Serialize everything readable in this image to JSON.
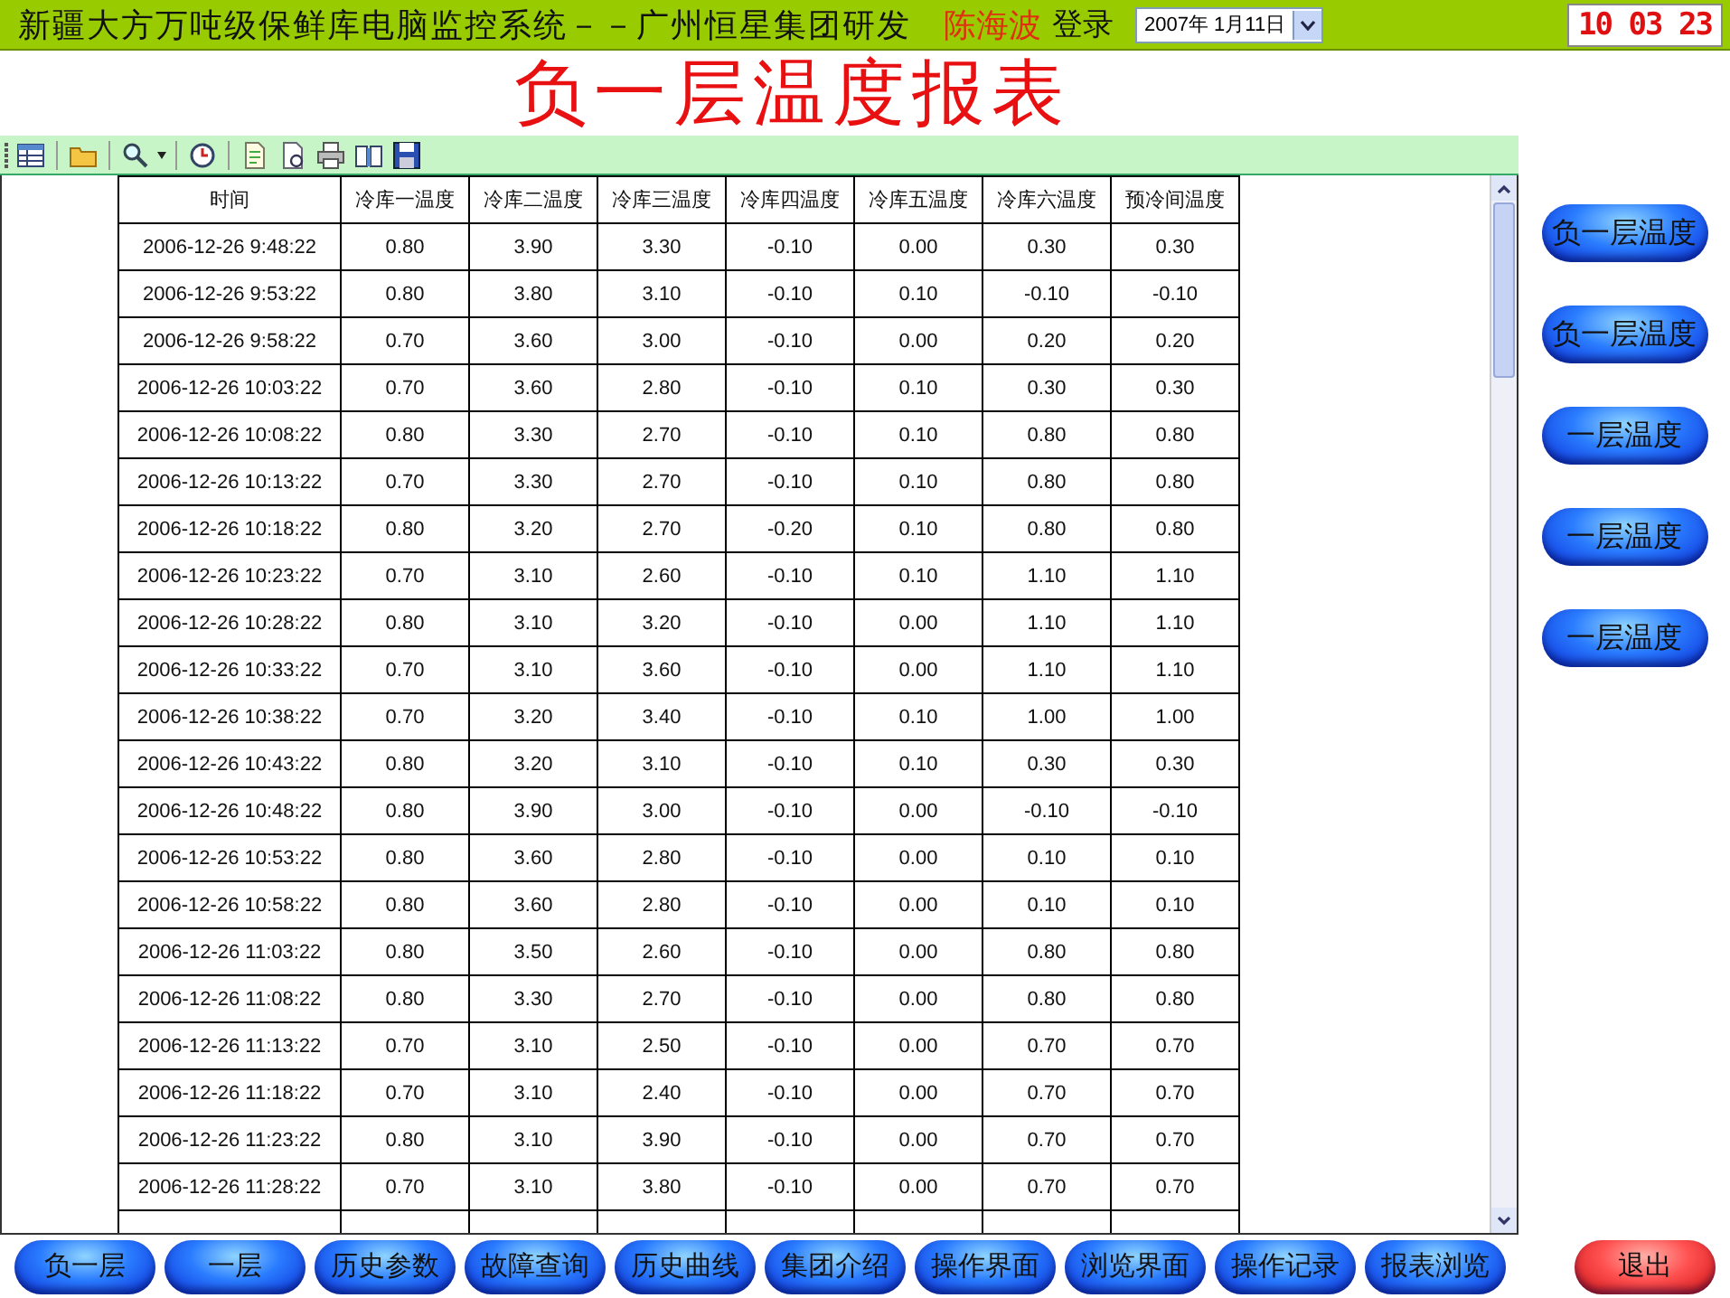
{
  "header": {
    "title": "新疆大方万吨级保鲜库电脑监控系统－－广州恒星集团研发",
    "user": "陈海波",
    "login": "登录",
    "date": "2007年 1月11日",
    "clock": "10 03 23"
  },
  "report_title": "负一层温度报表",
  "table": {
    "columns": [
      "时间",
      "冷库一温度",
      "冷库二温度",
      "冷库三温度",
      "冷库四温度",
      "冷库五温度",
      "冷库六温度",
      "预冷间温度"
    ],
    "rows": [
      [
        "2006-12-26 9:48:22",
        "0.80",
        "3.90",
        "3.30",
        "-0.10",
        "0.00",
        "0.30",
        "0.30"
      ],
      [
        "2006-12-26 9:53:22",
        "0.80",
        "3.80",
        "3.10",
        "-0.10",
        "0.10",
        "-0.10",
        "-0.10"
      ],
      [
        "2006-12-26 9:58:22",
        "0.70",
        "3.60",
        "3.00",
        "-0.10",
        "0.00",
        "0.20",
        "0.20"
      ],
      [
        "2006-12-26 10:03:22",
        "0.70",
        "3.60",
        "2.80",
        "-0.10",
        "0.10",
        "0.30",
        "0.30"
      ],
      [
        "2006-12-26 10:08:22",
        "0.80",
        "3.30",
        "2.70",
        "-0.10",
        "0.10",
        "0.80",
        "0.80"
      ],
      [
        "2006-12-26 10:13:22",
        "0.70",
        "3.30",
        "2.70",
        "-0.10",
        "0.10",
        "0.80",
        "0.80"
      ],
      [
        "2006-12-26 10:18:22",
        "0.80",
        "3.20",
        "2.70",
        "-0.20",
        "0.10",
        "0.80",
        "0.80"
      ],
      [
        "2006-12-26 10:23:22",
        "0.70",
        "3.10",
        "2.60",
        "-0.10",
        "0.10",
        "1.10",
        "1.10"
      ],
      [
        "2006-12-26 10:28:22",
        "0.80",
        "3.10",
        "3.20",
        "-0.10",
        "0.00",
        "1.10",
        "1.10"
      ],
      [
        "2006-12-26 10:33:22",
        "0.70",
        "3.10",
        "3.60",
        "-0.10",
        "0.00",
        "1.10",
        "1.10"
      ],
      [
        "2006-12-26 10:38:22",
        "0.70",
        "3.20",
        "3.40",
        "-0.10",
        "0.10",
        "1.00",
        "1.00"
      ],
      [
        "2006-12-26 10:43:22",
        "0.80",
        "3.20",
        "3.10",
        "-0.10",
        "0.10",
        "0.30",
        "0.30"
      ],
      [
        "2006-12-26 10:48:22",
        "0.80",
        "3.90",
        "3.00",
        "-0.10",
        "0.00",
        "-0.10",
        "-0.10"
      ],
      [
        "2006-12-26 10:53:22",
        "0.80",
        "3.60",
        "2.80",
        "-0.10",
        "0.00",
        "0.10",
        "0.10"
      ],
      [
        "2006-12-26 10:58:22",
        "0.80",
        "3.60",
        "2.80",
        "-0.10",
        "0.00",
        "0.10",
        "0.10"
      ],
      [
        "2006-12-26 11:03:22",
        "0.80",
        "3.50",
        "2.60",
        "-0.10",
        "0.00",
        "0.80",
        "0.80"
      ],
      [
        "2006-12-26 11:08:22",
        "0.80",
        "3.30",
        "2.70",
        "-0.10",
        "0.00",
        "0.80",
        "0.80"
      ],
      [
        "2006-12-26 11:13:22",
        "0.70",
        "3.10",
        "2.50",
        "-0.10",
        "0.00",
        "0.70",
        "0.70"
      ],
      [
        "2006-12-26 11:18:22",
        "0.70",
        "3.10",
        "2.40",
        "-0.10",
        "0.00",
        "0.70",
        "0.70"
      ],
      [
        "2006-12-26 11:23:22",
        "0.80",
        "3.10",
        "3.90",
        "-0.10",
        "0.00",
        "0.70",
        "0.70"
      ],
      [
        "2006-12-26 11:28:22",
        "0.70",
        "3.10",
        "3.80",
        "-0.10",
        "0.00",
        "0.70",
        "0.70"
      ]
    ]
  },
  "side_buttons": [
    "负一层温度",
    "负一层温度",
    "一层温度",
    "一层温度",
    "一层温度"
  ],
  "bottom_buttons": [
    {
      "label": "负一层",
      "kind": "nav"
    },
    {
      "label": "一层",
      "kind": "nav"
    },
    {
      "label": "历史参数",
      "kind": "nav"
    },
    {
      "label": "故障查询",
      "kind": "nav"
    },
    {
      "label": "历史曲线",
      "kind": "nav"
    },
    {
      "label": "集团介绍",
      "kind": "nav"
    },
    {
      "label": "操作界面",
      "kind": "nav"
    },
    {
      "label": "浏览界面",
      "kind": "nav"
    },
    {
      "label": "操作记录",
      "kind": "nav"
    },
    {
      "label": "报表浏览",
      "kind": "nav"
    },
    {
      "label": "退出",
      "kind": "exit"
    }
  ]
}
